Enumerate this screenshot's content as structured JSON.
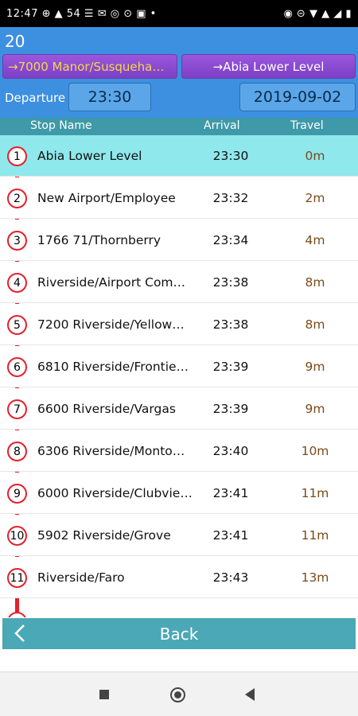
{
  "status_bar": {
    "left": "12:47 ⊕ ▲ 54 ☰ ✉ ◎ ⊙ ▣ •",
    "right": "◉ ⊝ ▼ ▲ ◢ ▮"
  },
  "header": {
    "route_number": "20",
    "direction_left": "→7000 Manor/Susqueha…",
    "direction_right": "→Abia Lower Level",
    "departure_label": "Departure",
    "departure_time": "23:30",
    "departure_date": "2019-09-02"
  },
  "columns": {
    "stop_name": "Stop Name",
    "arrival": "Arrival",
    "travel": "Travel"
  },
  "stops": [
    {
      "num": "1",
      "name": "Abia Lower Level",
      "arrival": "23:30",
      "travel": "0m",
      "active": true
    },
    {
      "num": "2",
      "name": "New Airport/Employee",
      "arrival": "23:32",
      "travel": "2m"
    },
    {
      "num": "3",
      "name": "1766 71/Thornberry",
      "arrival": "23:34",
      "travel": "4m"
    },
    {
      "num": "4",
      "name": "Riverside/Airport Com…",
      "arrival": "23:38",
      "travel": "8m"
    },
    {
      "num": "5",
      "name": "7200 Riverside/Yellow…",
      "arrival": "23:38",
      "travel": "8m"
    },
    {
      "num": "6",
      "name": "6810 Riverside/Frontie…",
      "arrival": "23:39",
      "travel": "9m"
    },
    {
      "num": "7",
      "name": "6600 Riverside/Vargas",
      "arrival": "23:39",
      "travel": "9m"
    },
    {
      "num": "8",
      "name": "6306 Riverside/Monto…",
      "arrival": "23:40",
      "travel": "10m"
    },
    {
      "num": "9",
      "name": "6000 Riverside/Clubvie…",
      "arrival": "23:41",
      "travel": "11m"
    },
    {
      "num": "10",
      "name": "5902 Riverside/Grove",
      "arrival": "23:41",
      "travel": "11m"
    },
    {
      "num": "11",
      "name": "Riverside/Faro",
      "arrival": "23:43",
      "travel": "13m"
    }
  ],
  "back_bar": {
    "label": "Back"
  },
  "colors": {
    "header_bg": "#3d8fe0",
    "direction_bg": "#8a48d0",
    "column_header_bg": "#3e99a8",
    "route_line": "#e4202a",
    "active_row": "#8fe8ec",
    "back_bar_bg": "#4aa8b7"
  },
  "icons": {
    "back": "chevron-left-icon",
    "nav_recents": "square-icon",
    "nav_home": "circle-icon",
    "nav_back": "triangle-left-icon"
  }
}
